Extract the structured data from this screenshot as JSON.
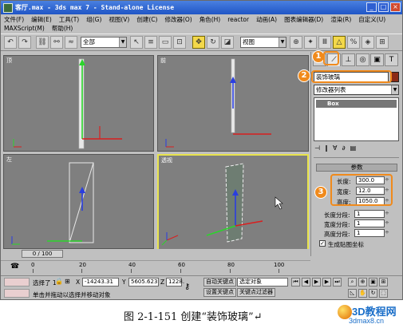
{
  "window": {
    "title": "客厅.max - 3ds max 7 - Stand-alone License",
    "minimize": "_",
    "maximize": "□",
    "close": "×"
  },
  "menu": {
    "row1": [
      "文件(F)",
      "编辑(E)",
      "工具(T)",
      "组(G)",
      "视图(V)",
      "创建(C)",
      "修改器(O)",
      "角色(H)",
      "reactor",
      "动画(A)",
      "图表编辑器(D)",
      "渲染(R)",
      "自定义(U)"
    ],
    "row2": [
      "MAXScript(M)",
      "帮助(H)"
    ]
  },
  "toolbar": {
    "selection_filter": "全部",
    "coord_system": "视图"
  },
  "viewports": {
    "top": "顶",
    "front": "前",
    "left": "左",
    "perspective": "透视"
  },
  "command_panel": {
    "object_name": "装饰玻璃",
    "modifier_list": "修改器列表",
    "stack_item": "Box",
    "rollout_title": "参数",
    "params": [
      {
        "label": "长度:",
        "value": "300.0"
      },
      {
        "label": "宽度:",
        "value": "12.0"
      },
      {
        "label": "高度:",
        "value": "1050.0"
      }
    ],
    "segments": [
      {
        "label": "长度分段:",
        "value": "1"
      },
      {
        "label": "宽度分段:",
        "value": "1"
      },
      {
        "label": "高度分段:",
        "value": "1"
      }
    ],
    "gen_uv": "生成贴图坐标",
    "gen_uv_checked": true,
    "accent_color": "#8b2b17"
  },
  "callouts": [
    "1",
    "2",
    "3"
  ],
  "timeline": {
    "frame_display": "0 / 100",
    "ticks": [
      "0",
      "20",
      "40",
      "60",
      "80",
      "100"
    ]
  },
  "status": {
    "selected": "选择了 1",
    "x_label": "X",
    "x": "-14243.31",
    "y_label": "Y",
    "y": "5605.623",
    "z_label": "Z",
    "z": "1228.",
    "auto_key": "自动关键点",
    "set_key": "设置关键点",
    "selection_set": "选定对象",
    "key_filters": "关键点过滤器",
    "prompt": "单击并拖动以选择并移动对象"
  },
  "caption": "图 2-1-151   创建“装饰玻璃”↵",
  "watermark": {
    "brand": "3D教程网",
    "url": "3dmax8.cn"
  }
}
